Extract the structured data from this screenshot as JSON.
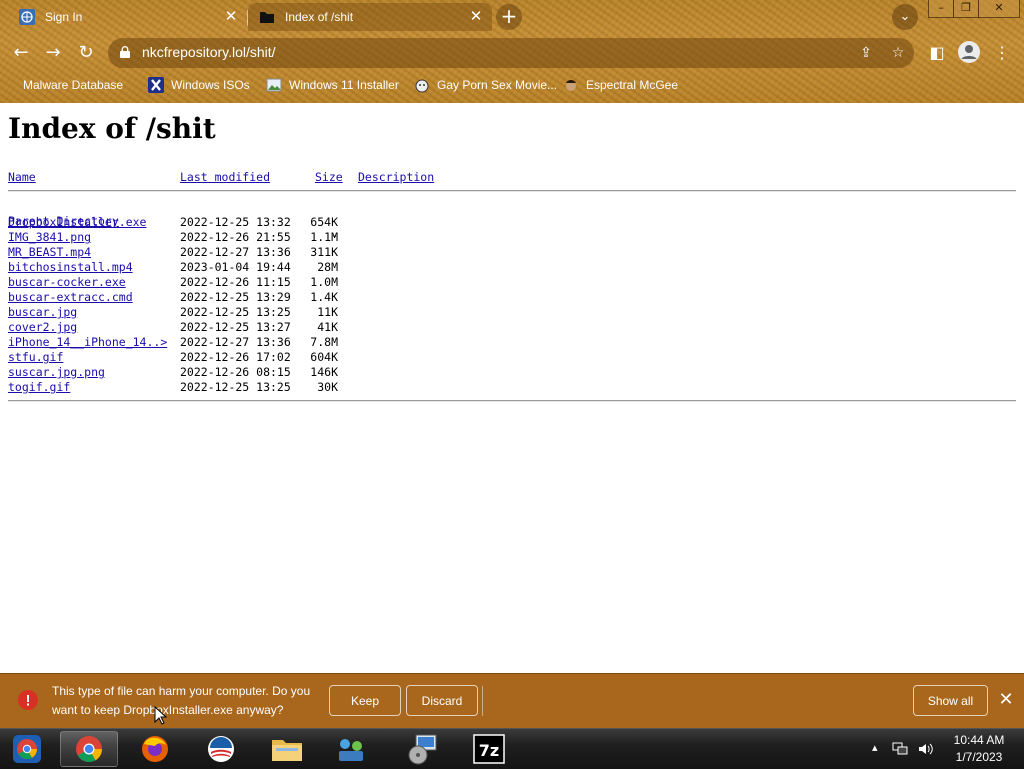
{
  "browser": {
    "tabs": [
      {
        "title": "Sign In",
        "favicon": "globe-icon"
      },
      {
        "title": "Index of /shit",
        "favicon": "folder-icon",
        "active": true
      }
    ],
    "url": "nkcfrepository.lol/shit/",
    "bookmarks": [
      {
        "label": "Malware Database",
        "icon": "leaf-icon"
      },
      {
        "label": "Windows ISOs",
        "icon": "x-icon"
      },
      {
        "label": "Windows 11 Installer",
        "icon": "image-icon"
      },
      {
        "label": "Gay Porn Sex Movie...",
        "icon": "pumpkin-icon"
      },
      {
        "label": "Espectral McGee",
        "icon": "face-icon"
      }
    ],
    "theme_color": "#c08a32"
  },
  "listing": {
    "title": "Index of /shit",
    "headers": {
      "name": "Name",
      "modified": "Last modified",
      "size": "Size",
      "description": "Description"
    },
    "parent": {
      "name": "Parent Directory",
      "size": "-"
    },
    "files": [
      {
        "name": "DropboxInstaller.exe",
        "modified": "2022-12-25 13:32",
        "size": "654K"
      },
      {
        "name": "IMG_3841.png",
        "modified": "2022-12-26 21:55",
        "size": "1.1M"
      },
      {
        "name": "MR_BEAST.mp4",
        "modified": "2022-12-27 13:36",
        "size": "311K"
      },
      {
        "name": "bitchosinstall.mp4",
        "modified": "2023-01-04 19:44",
        "size": "28M"
      },
      {
        "name": "buscar-cocker.exe",
        "modified": "2022-12-26 11:15",
        "size": "1.0M"
      },
      {
        "name": "buscar-extracc.cmd",
        "modified": "2022-12-25 13:29",
        "size": "1.4K"
      },
      {
        "name": "buscar.jpg",
        "modified": "2022-12-25 13:25",
        "size": "11K"
      },
      {
        "name": "cover2.jpg",
        "modified": "2022-12-25 13:27",
        "size": "41K"
      },
      {
        "name": "iPhone_14__iPhone_14..>",
        "modified": "2022-12-27 13:36",
        "size": "7.8M"
      },
      {
        "name": "stfu.gif",
        "modified": "2022-12-26 17:02",
        "size": "604K"
      },
      {
        "name": "suscar.jpg.png",
        "modified": "2022-12-26 08:15",
        "size": "146K"
      },
      {
        "name": "togif.gif",
        "modified": "2022-12-25 13:25",
        "size": "30K"
      }
    ]
  },
  "download_bar": {
    "warning": "This type of file can harm your computer. Do you want to keep DropboxInstaller.exe anyway?",
    "keep_label": "Keep",
    "discard_label": "Discard",
    "show_all_label": "Show all"
  },
  "taskbar": {
    "items": [
      "chrome-icon",
      "chrome-icon",
      "firefox-icon",
      "obama-icon",
      "explorer-icon",
      "network-icon",
      "installer-icon",
      "7zip-icon"
    ],
    "time": "10:44 AM",
    "date": "1/7/2023"
  }
}
